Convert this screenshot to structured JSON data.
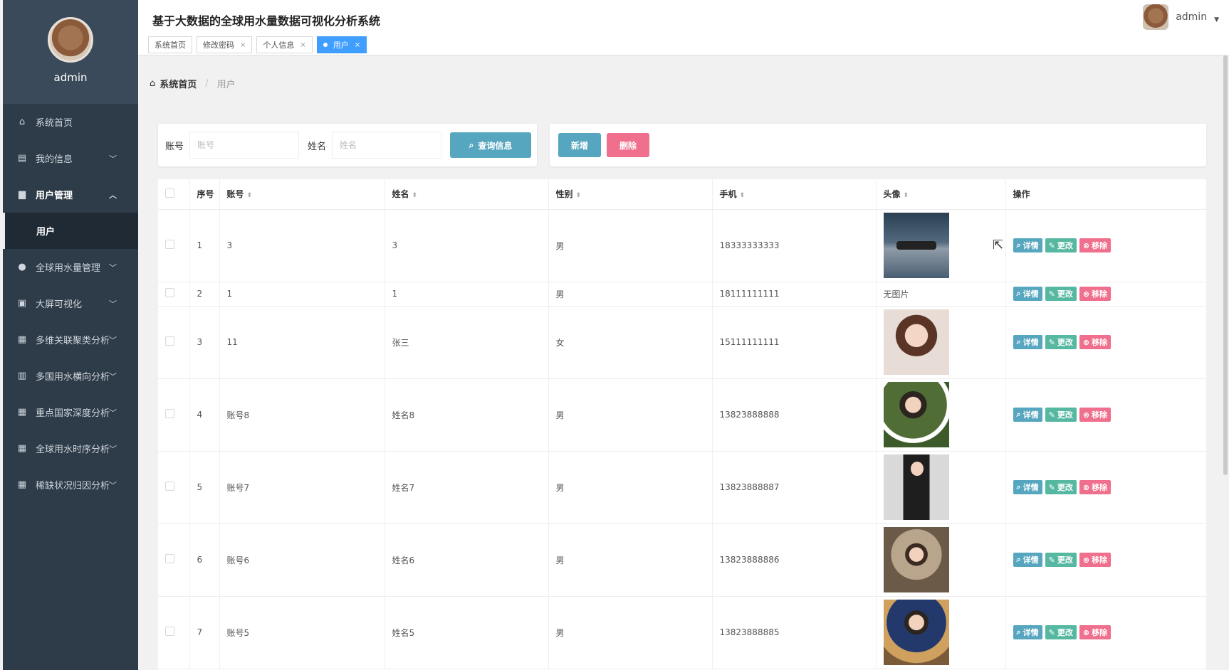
{
  "app": {
    "title": "基于大数据的全球用水量数据可视化分析系统"
  },
  "user": {
    "name": "admin"
  },
  "sidebar": {
    "profile_name": "admin",
    "items": [
      {
        "label": "系统首页",
        "icon": "home-icon"
      },
      {
        "label": "我的信息",
        "icon": "card-icon"
      },
      {
        "label": "用户管理",
        "icon": "user-group-icon",
        "expanded": true,
        "sub": "用户"
      },
      {
        "label": "全球用水量管理",
        "icon": "person-icon"
      },
      {
        "label": "大屏可视化",
        "icon": "clipboard-icon"
      },
      {
        "label": "多维关联聚类分析",
        "icon": "grid-icon"
      },
      {
        "label": "多国用水横向分析",
        "icon": "bar-icon"
      },
      {
        "label": "重点国家深度分析",
        "icon": "grid-icon"
      },
      {
        "label": "全球用水时序分析",
        "icon": "grid-icon"
      },
      {
        "label": "稀缺状况归因分析",
        "icon": "grid-icon"
      }
    ]
  },
  "tabs": [
    {
      "label": "系统首页"
    },
    {
      "label": "修改密码"
    },
    {
      "label": "个人信息"
    },
    {
      "label": "用户"
    }
  ],
  "breadcrumb": {
    "home": "系统首页",
    "current": "用户"
  },
  "search": {
    "account_label": "账号",
    "account_placeholder": "账号",
    "name_label": "姓名",
    "name_placeholder": "姓名",
    "button": "查询信息"
  },
  "actions": {
    "add": "新增",
    "delete": "删除"
  },
  "table": {
    "headers": [
      "序号",
      "账号",
      "姓名",
      "性别",
      "手机",
      "头像",
      "操作"
    ],
    "ops": {
      "detail": "详情",
      "edit": "更改",
      "remove": "移除"
    },
    "no_image": "无图片",
    "rows": [
      {
        "idx": "1",
        "account": "3",
        "name": "3",
        "gender": "男",
        "phone": "18333333333",
        "photo": "drone"
      },
      {
        "idx": "2",
        "account": "1",
        "name": "1",
        "gender": "男",
        "phone": "18111111111",
        "photo": "none"
      },
      {
        "idx": "3",
        "account": "11",
        "name": "张三",
        "gender": "女",
        "phone": "15111111111",
        "photo": "girl1"
      },
      {
        "idx": "4",
        "account": "账号8",
        "name": "姓名8",
        "gender": "男",
        "phone": "13823888888",
        "photo": "girl2"
      },
      {
        "idx": "5",
        "account": "账号7",
        "name": "姓名7",
        "gender": "男",
        "phone": "13823888887",
        "photo": "girl3"
      },
      {
        "idx": "6",
        "account": "账号6",
        "name": "姓名6",
        "gender": "男",
        "phone": "13823888886",
        "photo": "girl4"
      },
      {
        "idx": "7",
        "account": "账号5",
        "name": "姓名5",
        "gender": "男",
        "phone": "13823888885",
        "photo": "girl5"
      }
    ]
  },
  "colors": {
    "sidebar": "#2e3b48",
    "primary": "#56a6bf",
    "danger": "#ef6f8d",
    "success": "#57b8a2",
    "tab_active": "#409eff"
  }
}
